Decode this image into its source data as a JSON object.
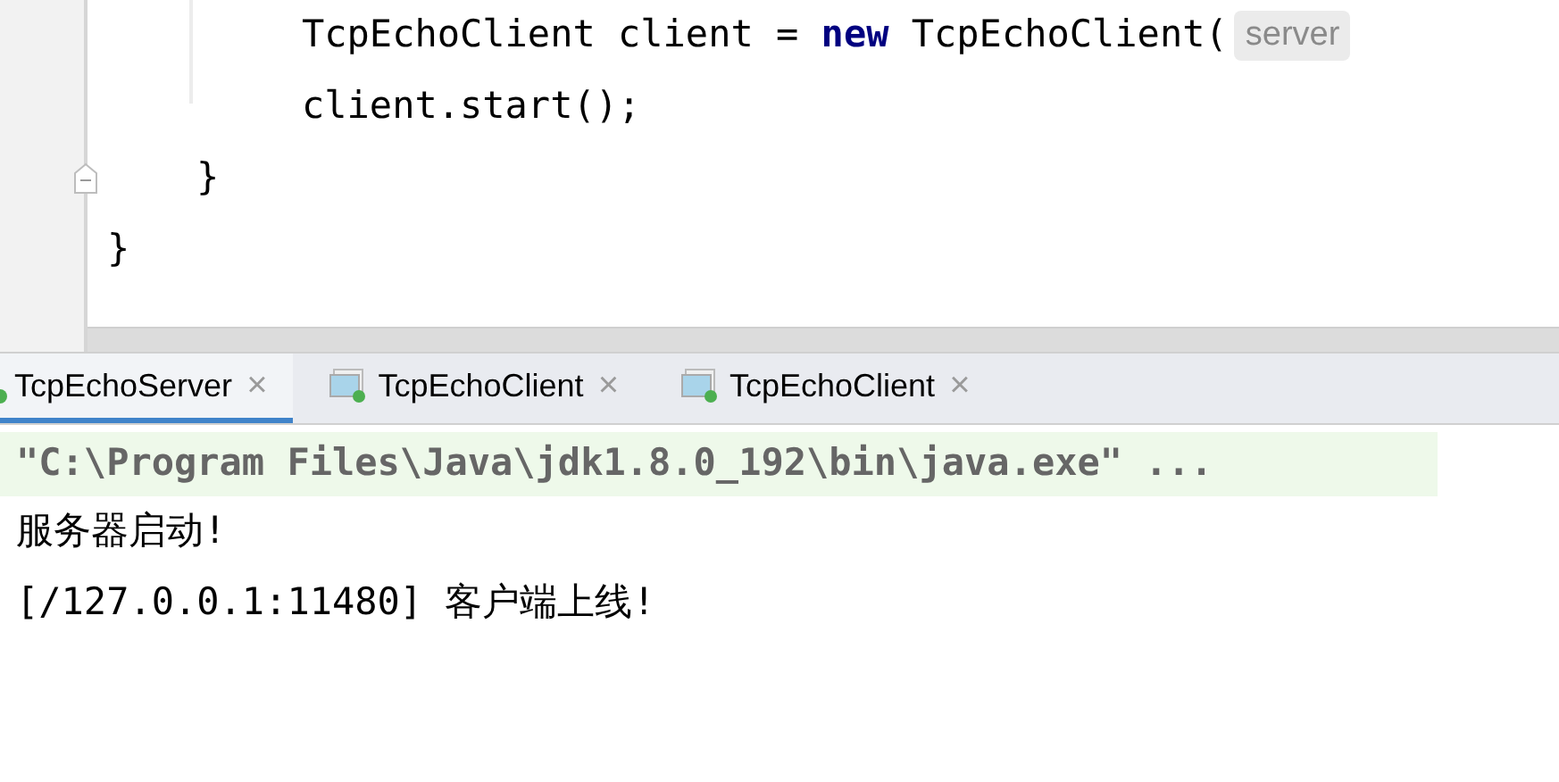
{
  "editor": {
    "lines": [
      {
        "tokens": [
          {
            "kind": "plain",
            "text": "TcpEchoClient client = "
          },
          {
            "kind": "keyword",
            "text": "new"
          },
          {
            "kind": "plain",
            "text": " TcpEchoClient("
          },
          {
            "kind": "hint",
            "text": "server"
          }
        ]
      },
      {
        "tokens": [
          {
            "kind": "plain",
            "text": "client.start();"
          }
        ]
      },
      {
        "tokens": [
          {
            "kind": "plain",
            "text": "}"
          }
        ],
        "fold": true
      },
      {
        "tokens": [
          {
            "kind": "plain",
            "text": "}"
          }
        ]
      }
    ]
  },
  "run_tabs": [
    {
      "label": "TcpEchoServer",
      "selected": true,
      "close": "×"
    },
    {
      "label": "TcpEchoClient",
      "selected": false,
      "close": "×"
    },
    {
      "label": "TcpEchoClient",
      "selected": false,
      "close": "×"
    }
  ],
  "console": [
    {
      "kind": "command",
      "text": "\"C:\\Program Files\\Java\\jdk1.8.0_192\\bin\\java.exe\" ..."
    },
    {
      "kind": "output",
      "text": "服务器启动!"
    },
    {
      "kind": "output",
      "text": "[/127.0.0.1:11480] 客户端上线!"
    }
  ]
}
